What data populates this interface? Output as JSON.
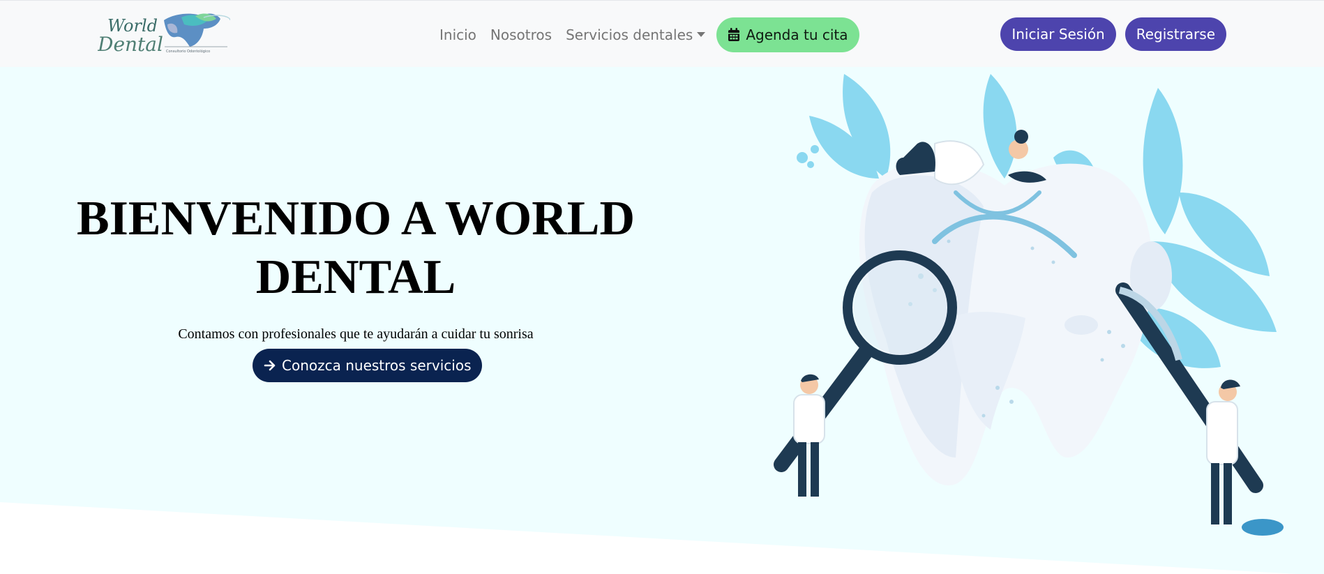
{
  "brand": {
    "logo_word1": "World",
    "logo_word2": "Dental",
    "logo_tagline": "Consultorio Odontológico"
  },
  "nav": {
    "links": [
      {
        "label": "Inicio"
      },
      {
        "label": "Nosotros"
      },
      {
        "label": "Servicios dentales"
      }
    ],
    "cita_button": {
      "label": "Agenda tu cita",
      "icon": "calendar-icon"
    }
  },
  "auth": {
    "login_label": "Iniciar Sesión",
    "register_label": "Registrarse"
  },
  "hero": {
    "title": "BIENVENIDO A WORLD DENTAL",
    "subtitle": "Contamos con profesionales que te ayudarán a cuidar tu sonrisa",
    "cta": {
      "label": "Conozca nuestros servicios",
      "icon": "arrow-right-icon"
    }
  },
  "colors": {
    "navbar_bg": "#f8f9fa",
    "hero_bg": "#effeff",
    "cita_button": "#7ce293",
    "auth_buttons": "#4d44ad",
    "cta_button": "#0a2350",
    "nav_text": "#757575"
  }
}
